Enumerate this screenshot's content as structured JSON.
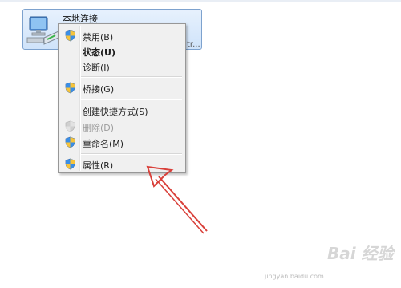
{
  "adapter": {
    "name": "本地连接",
    "device_fragment": "tr..."
  },
  "context_menu": {
    "items": [
      {
        "label": "禁用(B)",
        "icon": "shield-icon",
        "bold": false,
        "disabled": false
      },
      {
        "label": "状态(U)",
        "icon": "",
        "bold": true,
        "disabled": false
      },
      {
        "label": "诊断(I)",
        "icon": "",
        "bold": false,
        "disabled": false
      },
      {
        "label": "桥接(G)",
        "icon": "shield-icon",
        "bold": false,
        "disabled": false
      },
      {
        "label": "创建快捷方式(S)",
        "icon": "",
        "bold": false,
        "disabled": false
      },
      {
        "label": "删除(D)",
        "icon": "shield-icon-disabled",
        "bold": false,
        "disabled": true
      },
      {
        "label": "重命名(M)",
        "icon": "shield-icon",
        "bold": false,
        "disabled": false
      },
      {
        "label": "属性(R)",
        "icon": "shield-icon",
        "bold": false,
        "disabled": false
      }
    ]
  },
  "annotation": {
    "color": "#d9403a"
  },
  "watermark": {
    "brand": "Bai 经验",
    "url": "jingyan.baidu.com"
  }
}
